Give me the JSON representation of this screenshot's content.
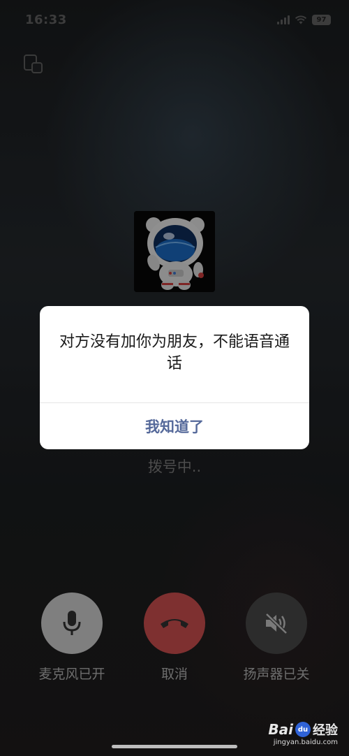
{
  "status_bar": {
    "time": "16:33",
    "battery": "97"
  },
  "call": {
    "status": "拨号中.."
  },
  "dialog": {
    "message": "对方没有加你为朋友，不能语音通话",
    "button_label": "我知道了"
  },
  "controls": {
    "mic_label": "麦克风已开",
    "cancel_label": "取消",
    "speaker_label": "扬声器已关"
  },
  "watermark": {
    "logo_left": "Bai",
    "logo_mid": "du",
    "logo_right": "经验",
    "url": "jingyan.baidu.com"
  },
  "colors": {
    "dialog_button": "#55699a",
    "cancel_button": "#7e3030",
    "mic_button": "#7f7f7f",
    "speaker_button": "#2c2c2c"
  },
  "icons": {
    "minimize": "picture-in-picture-icon",
    "mic": "microphone-icon",
    "cancel": "phone-hangup-icon",
    "speaker": "speaker-muted-icon"
  }
}
